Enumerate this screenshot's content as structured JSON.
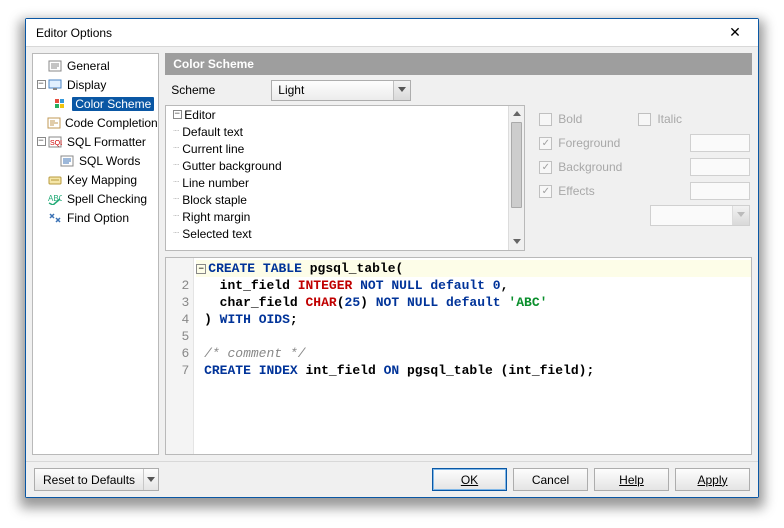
{
  "title": "Editor Options",
  "tree": {
    "general": "General",
    "display": "Display",
    "colorScheme": "Color Scheme",
    "codeCompletion": "Code Completion",
    "sqlFormatter": "SQL Formatter",
    "sqlWords": "SQL Words",
    "keyMapping": "Key Mapping",
    "spellChecking": "Spell Checking",
    "findOption": "Find Option"
  },
  "header": "Color Scheme",
  "scheme": {
    "label": "Scheme",
    "value": "Light"
  },
  "elements": {
    "group": "Editor",
    "items": [
      "Default text",
      "Current line",
      "Gutter background",
      "Line number",
      "Block staple",
      "Right margin",
      "Selected text"
    ]
  },
  "styles": {
    "bold": "Bold",
    "italic": "Italic",
    "foreground": "Foreground",
    "background": "Background",
    "effects": "Effects"
  },
  "buttons": {
    "reset": "Reset to Defaults",
    "ok": "OK",
    "cancel": "Cancel",
    "help": "Help",
    "apply": "Apply"
  },
  "code": {
    "l2n": "2",
    "l3n": "3",
    "l4n": "4",
    "l5n": "5",
    "l6n": "6",
    "l7n": "7"
  }
}
